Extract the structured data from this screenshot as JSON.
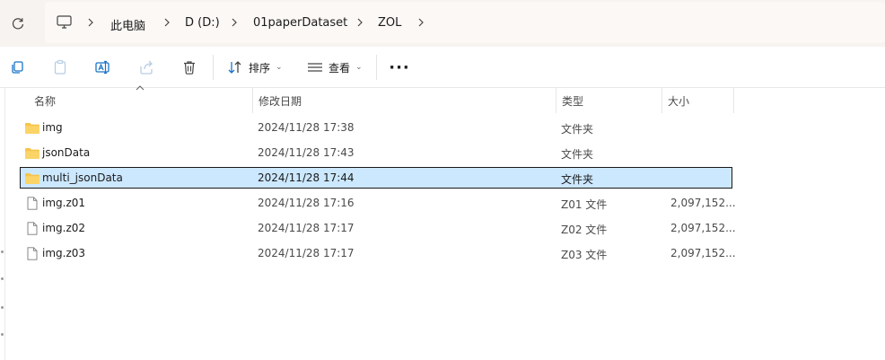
{
  "breadcrumb": {
    "items": [
      "此电脑",
      "D (D:)",
      "01paperDataset",
      "ZOL"
    ]
  },
  "toolbar": {
    "sort_label": "排序",
    "view_label": "查看",
    "more_label": "···"
  },
  "columns": {
    "name": "名称",
    "modified": "修改日期",
    "type": "类型",
    "size": "大小"
  },
  "files": [
    {
      "name": "img",
      "modified": "2024/11/28 17:38",
      "type": "文件夹",
      "size": "",
      "icon": "folder-icon",
      "selected": false
    },
    {
      "name": "jsonData",
      "modified": "2024/11/28 17:43",
      "type": "文件夹",
      "size": "",
      "icon": "folder-icon",
      "selected": false
    },
    {
      "name": "multi_jsonData",
      "modified": "2024/11/28 17:44",
      "type": "文件夹",
      "size": "",
      "icon": "folder-icon",
      "selected": true
    },
    {
      "name": "img.z01",
      "modified": "2024/11/28 17:16",
      "type": "Z01 文件",
      "size": "2,097,152...",
      "icon": "file-icon",
      "selected": false
    },
    {
      "name": "img.z02",
      "modified": "2024/11/28 17:17",
      "type": "Z02 文件",
      "size": "2,097,152...",
      "icon": "file-icon",
      "selected": false
    },
    {
      "name": "img.z03",
      "modified": "2024/11/28 17:17",
      "type": "Z03 文件",
      "size": "2,097,152...",
      "icon": "file-icon",
      "selected": false
    }
  ],
  "colors": {
    "folder": "#f7c34b",
    "selection": "#cce8ff",
    "accent": "#1a73c8"
  }
}
